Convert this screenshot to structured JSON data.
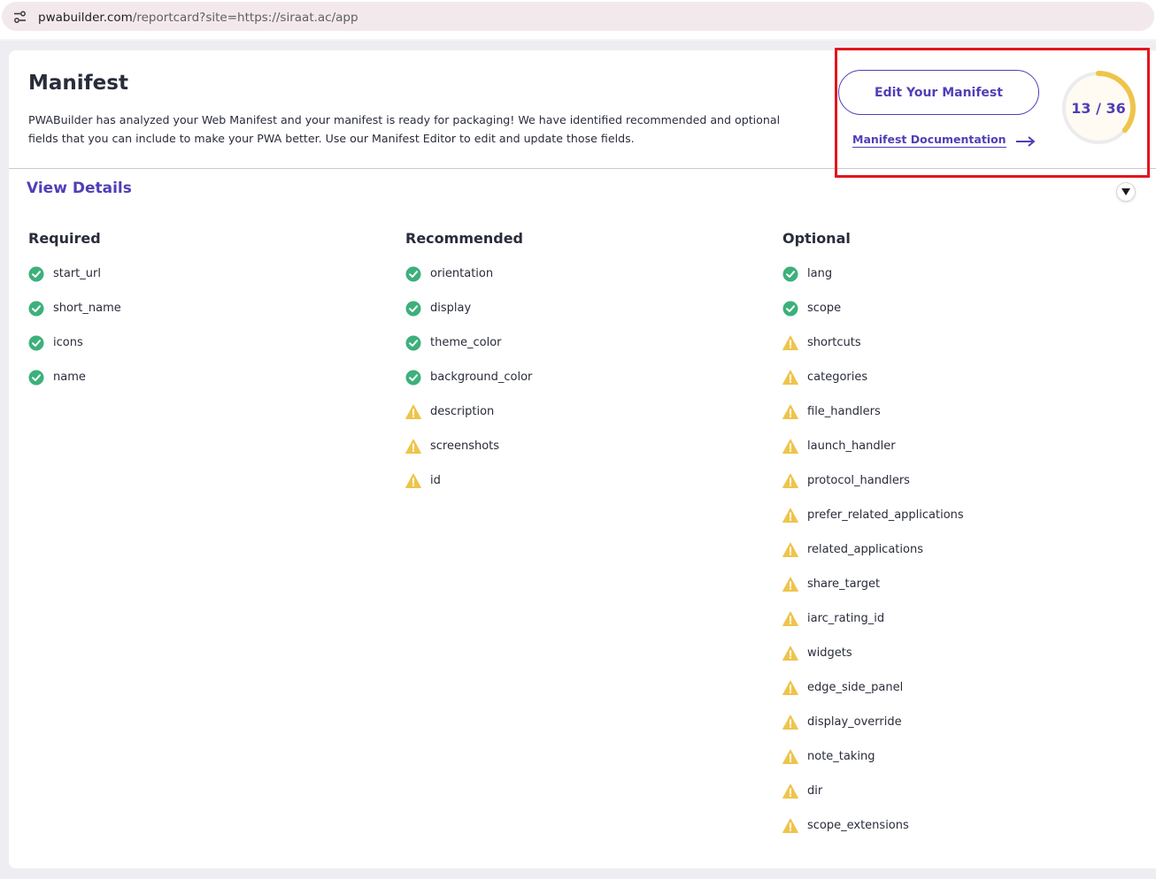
{
  "browser": {
    "url_host": "pwabuilder.com",
    "url_path": "/reportcard?site=https://siraat.ac/app",
    "site_info_icon": "tune-icon"
  },
  "card": {
    "title": "Manifest",
    "description": "PWABuilder has analyzed your Web Manifest and your manifest is ready for packaging! We have identified recommended and optional fields that you can include to make your PWA better. Use our Manifest Editor to edit and update those fields.",
    "edit_button_label": "Edit Your Manifest",
    "documentation_link_label": "Manifest Documentation",
    "score": {
      "text": "13 / 36",
      "value": 13,
      "max": 36
    },
    "view_details_label": "View Details"
  },
  "colors": {
    "accent": "#4f3fb6",
    "pass_green": "#3db07c",
    "warn_yellow": "#eec44c",
    "ring_track": "#ececec",
    "highlight_red": "#e2161e"
  },
  "columns": [
    {
      "heading": "Required",
      "items": [
        {
          "label": "start_url",
          "status": "pass"
        },
        {
          "label": "short_name",
          "status": "pass"
        },
        {
          "label": "icons",
          "status": "pass"
        },
        {
          "label": "name",
          "status": "pass"
        }
      ]
    },
    {
      "heading": "Recommended",
      "items": [
        {
          "label": "orientation",
          "status": "pass"
        },
        {
          "label": "display",
          "status": "pass"
        },
        {
          "label": "theme_color",
          "status": "pass"
        },
        {
          "label": "background_color",
          "status": "pass"
        },
        {
          "label": "description",
          "status": "warning"
        },
        {
          "label": "screenshots",
          "status": "warning"
        },
        {
          "label": "id",
          "status": "warning"
        }
      ]
    },
    {
      "heading": "Optional",
      "items": [
        {
          "label": "lang",
          "status": "pass"
        },
        {
          "label": "scope",
          "status": "pass"
        },
        {
          "label": "shortcuts",
          "status": "warning"
        },
        {
          "label": "categories",
          "status": "warning"
        },
        {
          "label": "file_handlers",
          "status": "warning"
        },
        {
          "label": "launch_handler",
          "status": "warning"
        },
        {
          "label": "protocol_handlers",
          "status": "warning"
        },
        {
          "label": "prefer_related_applications",
          "status": "warning"
        },
        {
          "label": "related_applications",
          "status": "warning"
        },
        {
          "label": "share_target",
          "status": "warning"
        },
        {
          "label": "iarc_rating_id",
          "status": "warning"
        },
        {
          "label": "widgets",
          "status": "warning"
        },
        {
          "label": "edge_side_panel",
          "status": "warning"
        },
        {
          "label": "display_override",
          "status": "warning"
        },
        {
          "label": "note_taking",
          "status": "warning"
        },
        {
          "label": "dir",
          "status": "warning"
        },
        {
          "label": "scope_extensions",
          "status": "warning"
        }
      ]
    }
  ]
}
